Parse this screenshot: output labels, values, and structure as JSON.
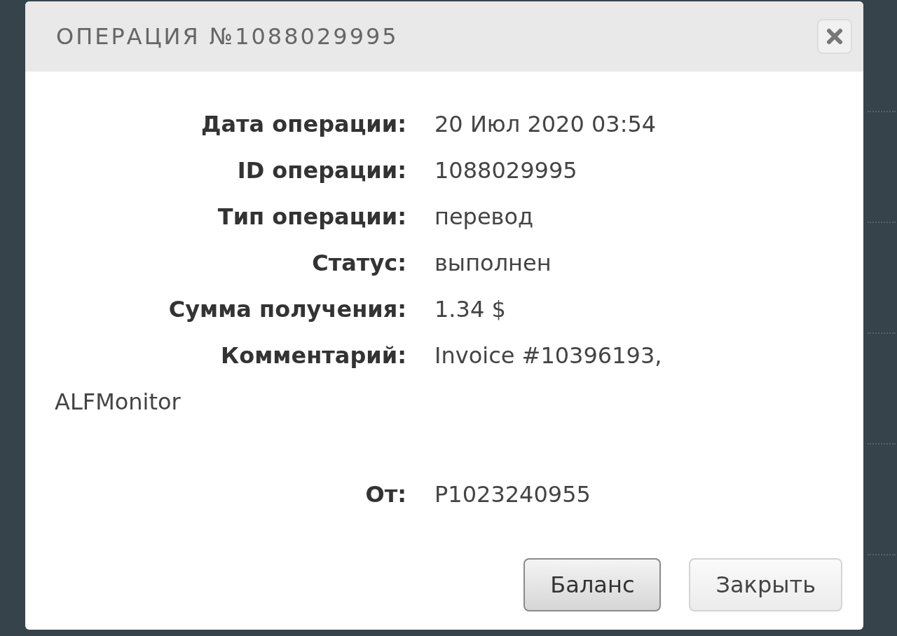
{
  "dialog": {
    "title": "ОПЕРАЦИЯ №1088029995",
    "fields": [
      {
        "label": "Дата операции:",
        "value": "20 Июл 2020 03:54"
      },
      {
        "label": "ID операции:",
        "value": "1088029995"
      },
      {
        "label": "Тип операции:",
        "value": "перевод"
      },
      {
        "label": "Статус:",
        "value": "выполнен"
      },
      {
        "label": "Сумма получения:",
        "value": "1.34 $"
      },
      {
        "label": "Комментарий:",
        "value": "Invoice #10396193,",
        "continuation": "ALFMonitor"
      }
    ],
    "from": {
      "label": "От:",
      "value": "P1023240955"
    },
    "buttons": [
      {
        "label": "Баланс",
        "primary": true
      },
      {
        "label": "Закрыть",
        "primary": false
      }
    ]
  }
}
